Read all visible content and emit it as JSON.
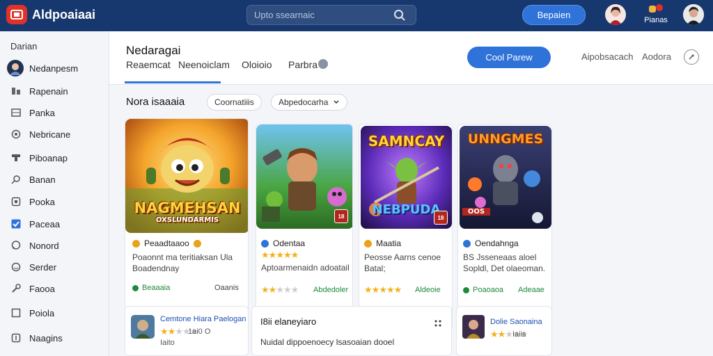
{
  "topbar": {
    "title": "Aldpoaiaai",
    "search_placeholder": "Upto ssearnaic",
    "primary_button": "Bepaien",
    "notification_label": "Pianas"
  },
  "sidebar": {
    "heading": "Darian",
    "items": [
      {
        "label": "Nedanpesm",
        "icon": "avatar-icon"
      },
      {
        "label": "Rapenain",
        "icon": "people-icon"
      },
      {
        "label": "Panka",
        "icon": "grid-icon"
      },
      {
        "label": "Nebricane",
        "icon": "circle-icon"
      },
      {
        "label": "Piboanap",
        "icon": "tag-icon"
      },
      {
        "label": "Banan",
        "icon": "search-icon"
      },
      {
        "label": "Pooka",
        "icon": "box-icon"
      },
      {
        "label": "Paceaa",
        "icon": "checkbox-icon"
      },
      {
        "label": "Nonord",
        "icon": "chat-icon"
      },
      {
        "label": "Serder",
        "icon": "settings-icon"
      },
      {
        "label": "Faooa",
        "icon": "wrench-icon"
      },
      {
        "label": "Poiola",
        "icon": "square-icon"
      },
      {
        "label": "Naagins",
        "icon": "plugin-icon"
      }
    ]
  },
  "header": {
    "page_title": "Nedaragai",
    "tabs": [
      "Reaemcat",
      "Neenoiclam",
      "Oloioio",
      "Parbra"
    ],
    "action_button": "Cool Parew",
    "links": [
      "Aipobsacach",
      "Aodora"
    ]
  },
  "section": {
    "title": "Nora isaaaia",
    "chip_1": "Coornatiiis",
    "chip_2": "Abpedocarha"
  },
  "games": [
    {
      "cover_title": "NAGMEHSAN",
      "cover_sub": "OXSLUNDARMIS",
      "name": "Peaadtaaoo",
      "desc_1": "Poaonnt ma teritiaksan Ula",
      "desc_2": "Boadendnay",
      "rating": 0,
      "foot_left": "Beaaaia",
      "foot_right": "Oaanis",
      "badge_color": "#e8a21c"
    },
    {
      "cover_title": "",
      "cover_sub": "",
      "name": "Odentaa",
      "desc_1": "",
      "desc_2": "Aptoarmenaidn adoatail",
      "rating": 4.5,
      "foot_left": "",
      "foot_right": "Abdedoler",
      "badge_color": "#2f72d8"
    },
    {
      "cover_title": "SAMNCAY",
      "cover_sub": "NEBPUDA",
      "name": "Maatia",
      "desc_1": "Peosse Aarns cenoe",
      "desc_2": "Batal;",
      "rating": 5,
      "foot_left": "",
      "foot_right": "Aldeoie",
      "badge_color": "#e8a21c"
    },
    {
      "cover_title": "UNNGMES",
      "cover_sub": "OOS",
      "name": "Oendahnga",
      "desc_1": "BS Jsseneaas aloel",
      "desc_2": "Sopldl, Det olaeoman.",
      "rating": 0,
      "foot_left": "Poaoaoa",
      "foot_right": "Adeaae",
      "badge_color": "#2f72d8"
    }
  ],
  "bottom": {
    "card1_title": "Cemtone Hiara Paelogan",
    "card1_rating_text": "1ai0 O",
    "card1_sub": "Iaito",
    "card2_title": "I8ii elaneyiaro",
    "card2_desc": "Nuidal dippoenoecy lsasoaian dooel",
    "card3_title": "Dolie Saonaina",
    "card3_rating_text": "Iaiis"
  },
  "colors": {
    "accent": "#2f72d8",
    "topbar": "#17386e",
    "star": "#f2b11c",
    "success": "#1d8a3a"
  }
}
